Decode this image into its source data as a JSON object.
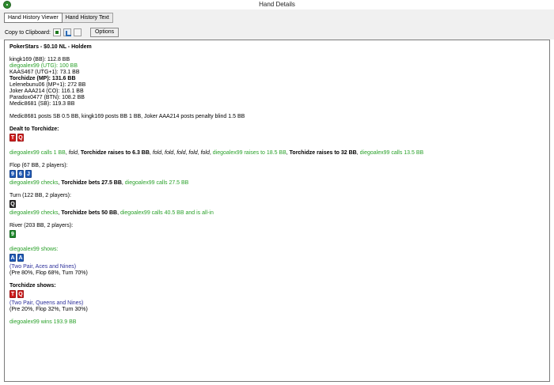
{
  "window": {
    "title": "Hand Details",
    "app_icon": "poker-chip-icon"
  },
  "toolbar": {
    "tabs": [
      {
        "label": "Hand History Viewer"
      },
      {
        "label": "Hand History Text"
      }
    ],
    "clipboard_label": "Copy to Clipboard:",
    "clipboard_buttons": [
      "image-copy-icon",
      "formatted-copy-icon",
      "plain-copy-icon"
    ],
    "options_label": "Options"
  },
  "hand": {
    "header": "PokerStars - $0.10 NL - Holdem",
    "players": [
      {
        "text": "kingk169 (BB): 112.8 BB",
        "style": "normal"
      },
      {
        "text": "diegoalex99 (UTG): 100 BB",
        "style": "green"
      },
      {
        "text": "KAAS467 (UTG+1): 73.1 BB",
        "style": "normal"
      },
      {
        "text": "Torchidze (MP): 131.6 BB",
        "style": "bold"
      },
      {
        "text": "Lelenebunu06 (MP+1): 272 BB",
        "style": "normal"
      },
      {
        "text": "Joker AAA214 (CO): 116.1 BB",
        "style": "normal"
      },
      {
        "text": "Paradox0477 (BTN): 108.2 BB",
        "style": "normal"
      },
      {
        "text": "Medic8681 (SB): 119.3 BB",
        "style": "normal"
      }
    ],
    "blinds": "Medic8681 posts SB 0.5 BB, kingk169 posts BB 1 BB, Joker AAA214 posts penalty blind 1.5 BB",
    "dealt_label": "Dealt to Torchidze:",
    "dealt_cards": [
      {
        "rank": "T",
        "color": "red"
      },
      {
        "rank": "Q",
        "color": "red"
      }
    ],
    "preflop": {
      "a1": "diegoalex99 calls 1 BB",
      "sep": ", ",
      "f1": "fold",
      "a2": "Torchidze raises to 6.3 BB",
      "f2": "fold",
      "f3": "fold",
      "f4": "fold",
      "f5": "fold",
      "f6": "fold",
      "a3": "diegoalex99 raises to 18.5 BB",
      "a4": "Torchidze raises to 32 BB",
      "a5": "diegoalex99 calls 13.5 BB"
    },
    "flop": {
      "label": "Flop (67 BB, 2 players):",
      "cards": [
        {
          "rank": "9",
          "color": "blue"
        },
        {
          "rank": "6",
          "color": "blue"
        },
        {
          "rank": "J",
          "color": "blue"
        }
      ],
      "a1": "diegoalex99 checks",
      "sep": ", ",
      "a2": "Torchidze bets 27.5 BB",
      "a3": "diegoalex99 calls 27.5 BB"
    },
    "turn": {
      "label": "Turn (122 BB, 2 players):",
      "cards": [
        {
          "rank": "Q",
          "color": "black"
        }
      ],
      "a1": "diegoalex99 checks",
      "sep": ", ",
      "a2": "Torchidze bets 50 BB",
      "a3": "diegoalex99 calls 40.5 BB and is all-in"
    },
    "river": {
      "label": "River (203 BB, 2 players):",
      "cards": [
        {
          "rank": "9",
          "color": "green"
        }
      ]
    },
    "showdown": [
      {
        "label": "diegoalex99 shows:",
        "label_style": "green",
        "cards": [
          {
            "rank": "A",
            "color": "blue"
          },
          {
            "rank": "A",
            "color": "blue"
          }
        ],
        "hand": "(Two Pair, Aces and Nines)",
        "odds": "(Pre 80%, Flop 68%, Turn 70%)"
      },
      {
        "label": "Torchidze shows:",
        "label_style": "bold",
        "cards": [
          {
            "rank": "T",
            "color": "red"
          },
          {
            "rank": "Q",
            "color": "red"
          }
        ],
        "hand": "(Two Pair, Queens and Nines)",
        "odds": "(Pre 20%, Flop 32%, Turn 30%)"
      }
    ],
    "result": "diegoalex99 wins 193.9 BB"
  }
}
